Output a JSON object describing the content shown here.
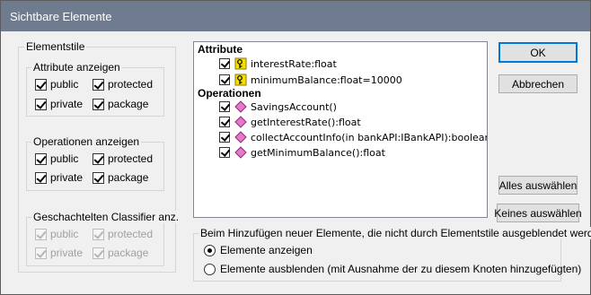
{
  "dialog": {
    "title": "Sichtbare Elemente"
  },
  "styles": {
    "label": "Elementstile",
    "attributes": {
      "label": "Attribute anzeigen",
      "public": "public",
      "protected": "protected",
      "private": "private",
      "package": "package"
    },
    "operations": {
      "label": "Operationen anzeigen",
      "public": "public",
      "protected": "protected",
      "private": "private",
      "package": "package"
    },
    "nested": {
      "label": "Geschachtelten Classifier anz.",
      "public": "public",
      "protected": "protected",
      "private": "private",
      "package": "package"
    }
  },
  "tree": {
    "attributes_header": "Attribute",
    "attributes": [
      "interestRate:float",
      "minimumBalance:float=10000"
    ],
    "operations_header": "Operationen",
    "operations": [
      "SavingsAccount()",
      "getInterestRate():float",
      "collectAccountInfo(in bankAPI:IBankAPI):boolean",
      "getMinimumBalance():float"
    ]
  },
  "buttons": {
    "ok": "OK",
    "cancel": "Abbrechen",
    "select_all": "Alles auswählen",
    "select_none": "Keines auswählen"
  },
  "new_elements": {
    "label": "Beim Hinzufügen neuer Elemente, die nicht durch Elementstile ausgeblendet werden",
    "show": "Elemente anzeigen",
    "hide": "Elemente ausblenden (mit Ausnahme der zu diesem Knoten hinzugefügten)"
  },
  "colors": {
    "titlebar": "#6f7b8e",
    "attribute_icon": "#f5e000",
    "operation_icon": "#e879c8"
  },
  "icons": {
    "attribute": "key-icon",
    "operation": "diamond-icon"
  }
}
